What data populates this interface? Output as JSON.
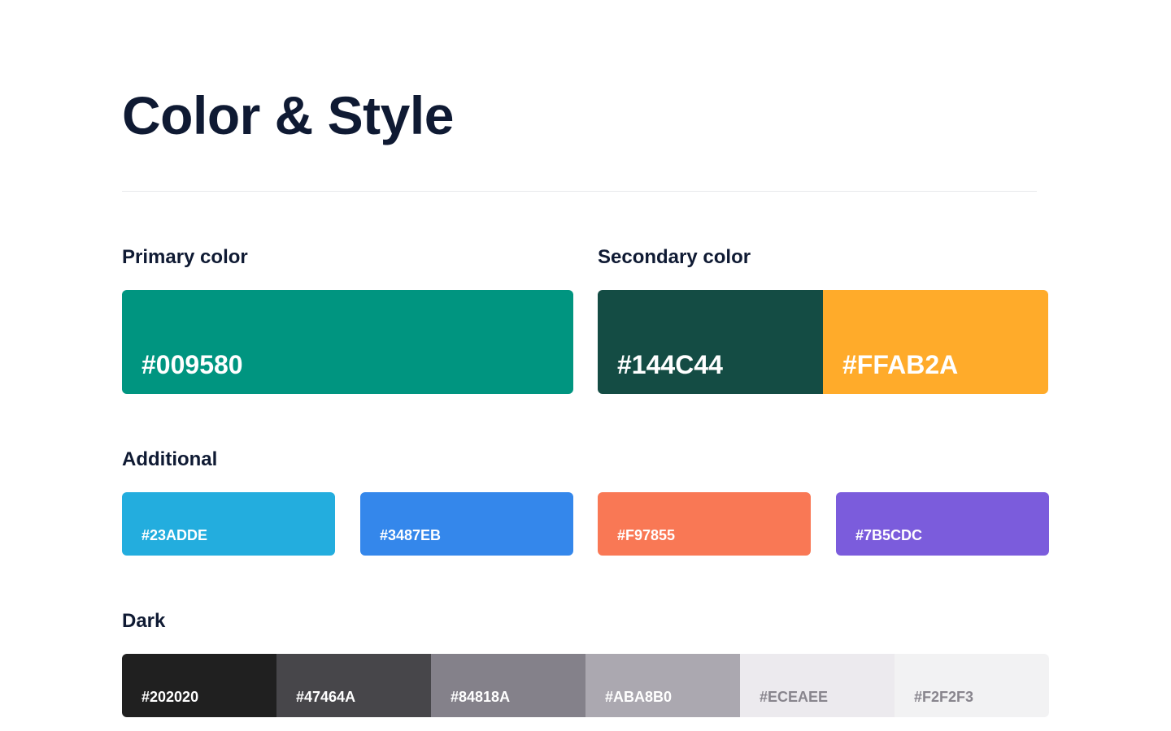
{
  "title": "Color & Style",
  "primary": {
    "label": "Primary color",
    "swatch": {
      "hex": "#009580",
      "color": "#009580"
    }
  },
  "secondary": {
    "label": "Secondary color",
    "swatches": [
      {
        "hex": "#144C44",
        "color": "#144C44"
      },
      {
        "hex": "#FFAB2A",
        "color": "#FFAB2A"
      }
    ]
  },
  "additional": {
    "label": "Additional",
    "swatches": [
      {
        "hex": "#23ADDE",
        "color": "#23ADDE"
      },
      {
        "hex": "#3487EB",
        "color": "#3487EB"
      },
      {
        "hex": "#F97855",
        "color": "#F97855"
      },
      {
        "hex": "#7B5CDC",
        "color": "#7B5CDC"
      }
    ]
  },
  "dark": {
    "label": "Dark",
    "swatches": [
      {
        "hex": "#202020",
        "color": "#202020"
      },
      {
        "hex": "#47464A",
        "color": "#47464A"
      },
      {
        "hex": "#84818A",
        "color": "#84818A"
      },
      {
        "hex": "#ABA8B0",
        "color": "#ABA8B0"
      },
      {
        "hex": "#ECEAEE",
        "color": "#ECEAEE"
      },
      {
        "hex": "#F2F2F3",
        "color": "#F2F2F3"
      }
    ]
  }
}
